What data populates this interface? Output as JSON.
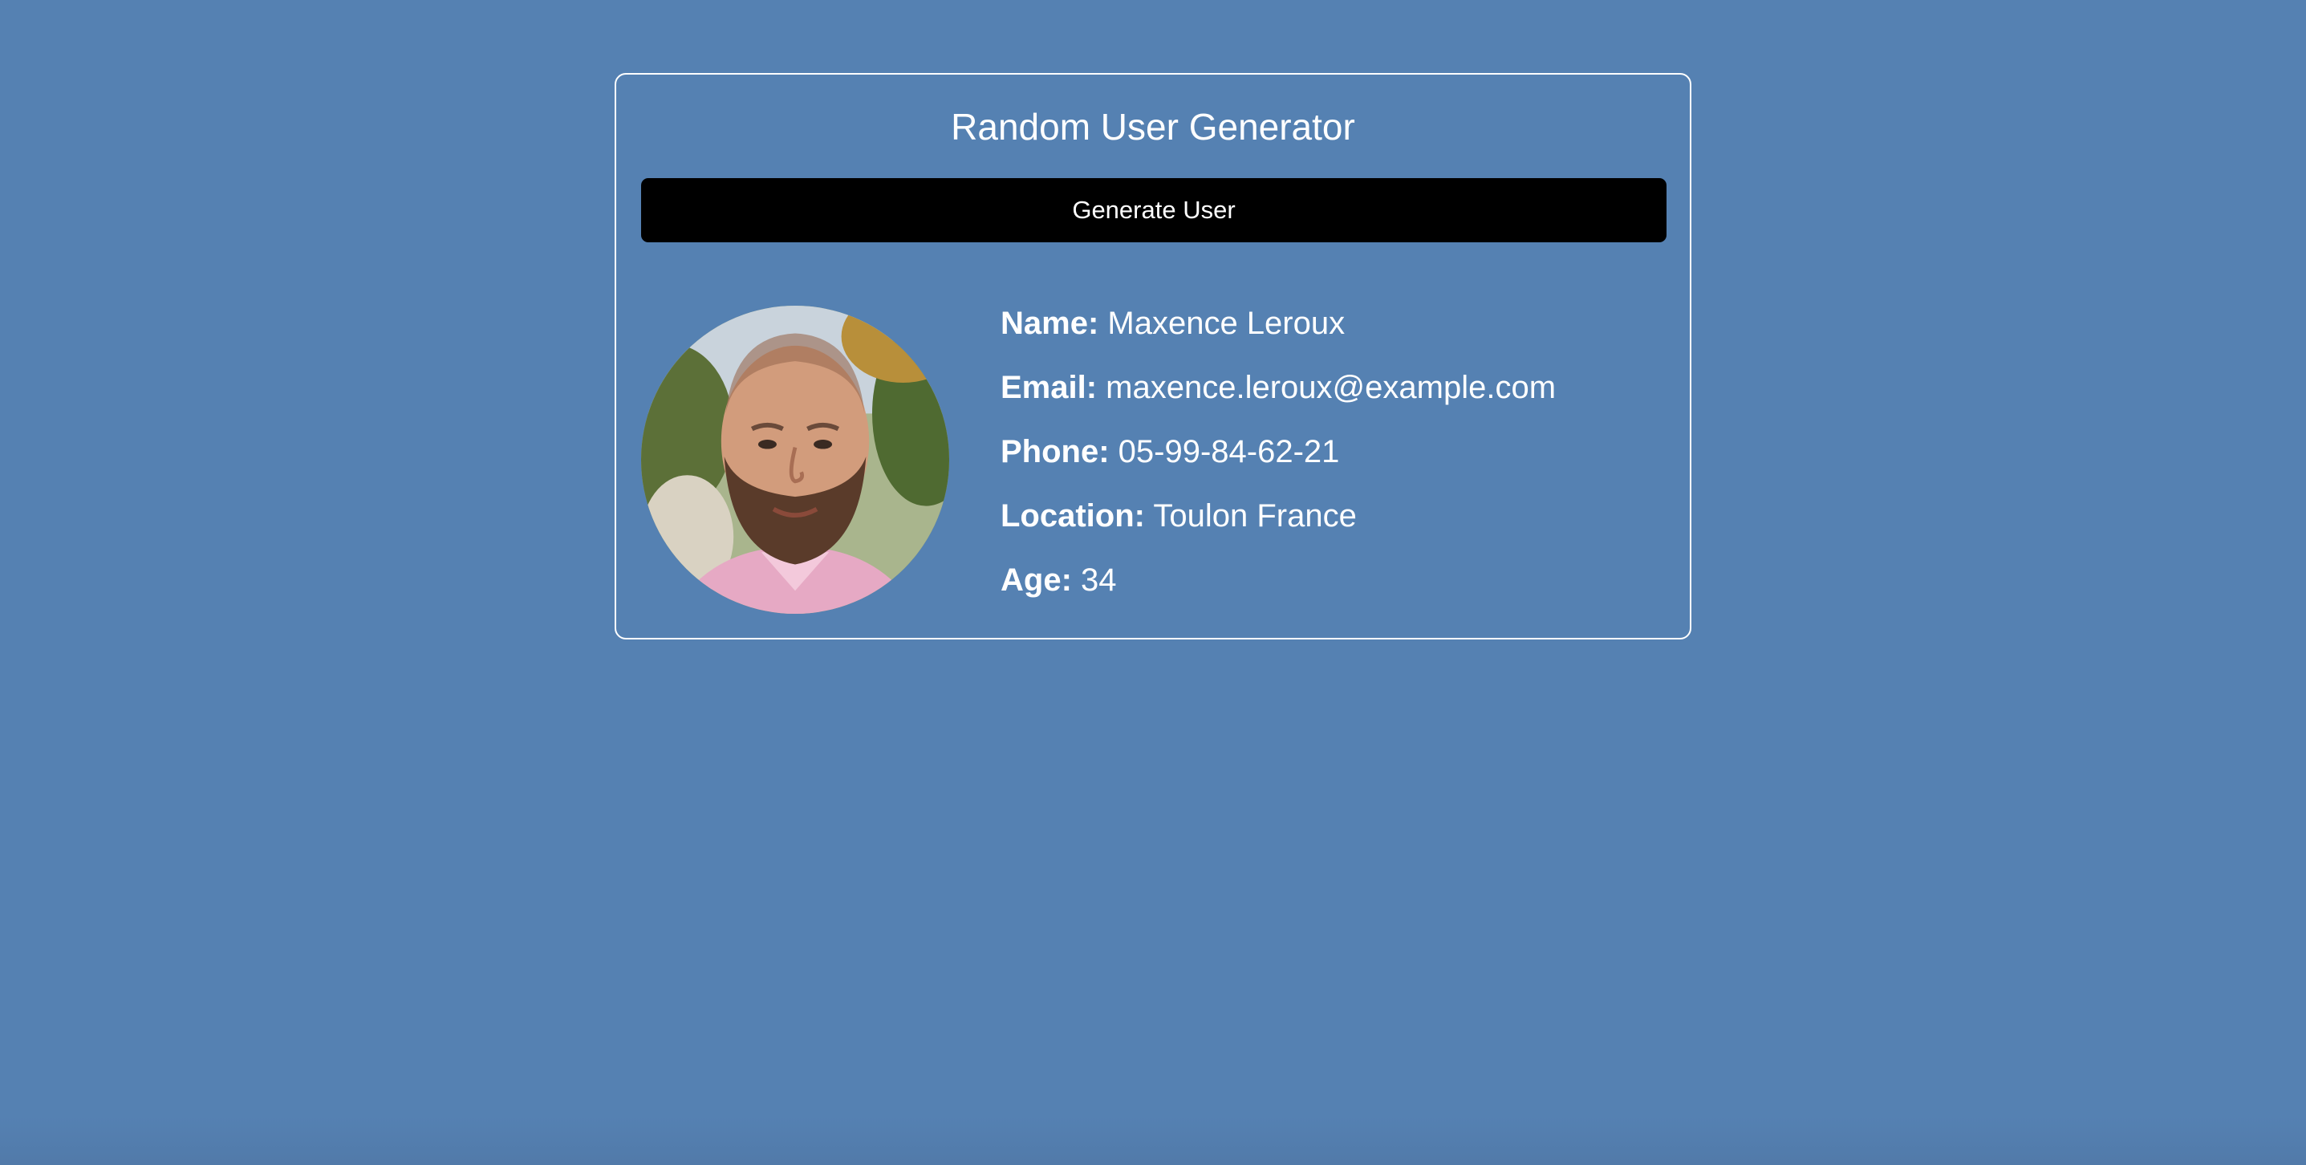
{
  "app": {
    "title": "Random User Generator",
    "generate_button_label": "Generate User"
  },
  "user": {
    "avatar_icon": "user-avatar-photo",
    "fields": [
      {
        "label": "Name:",
        "value": "Maxence Leroux"
      },
      {
        "label": "Email:",
        "value": "maxence.leroux@example.com"
      },
      {
        "label": "Phone:",
        "value": "05-99-84-62-21"
      },
      {
        "label": "Location:",
        "value": "Toulon France"
      },
      {
        "label": "Age:",
        "value": "34"
      }
    ]
  },
  "colors": {
    "background": "#5581b2",
    "card_border": "#ffffff",
    "button_background": "#000000",
    "text": "#ffffff"
  }
}
